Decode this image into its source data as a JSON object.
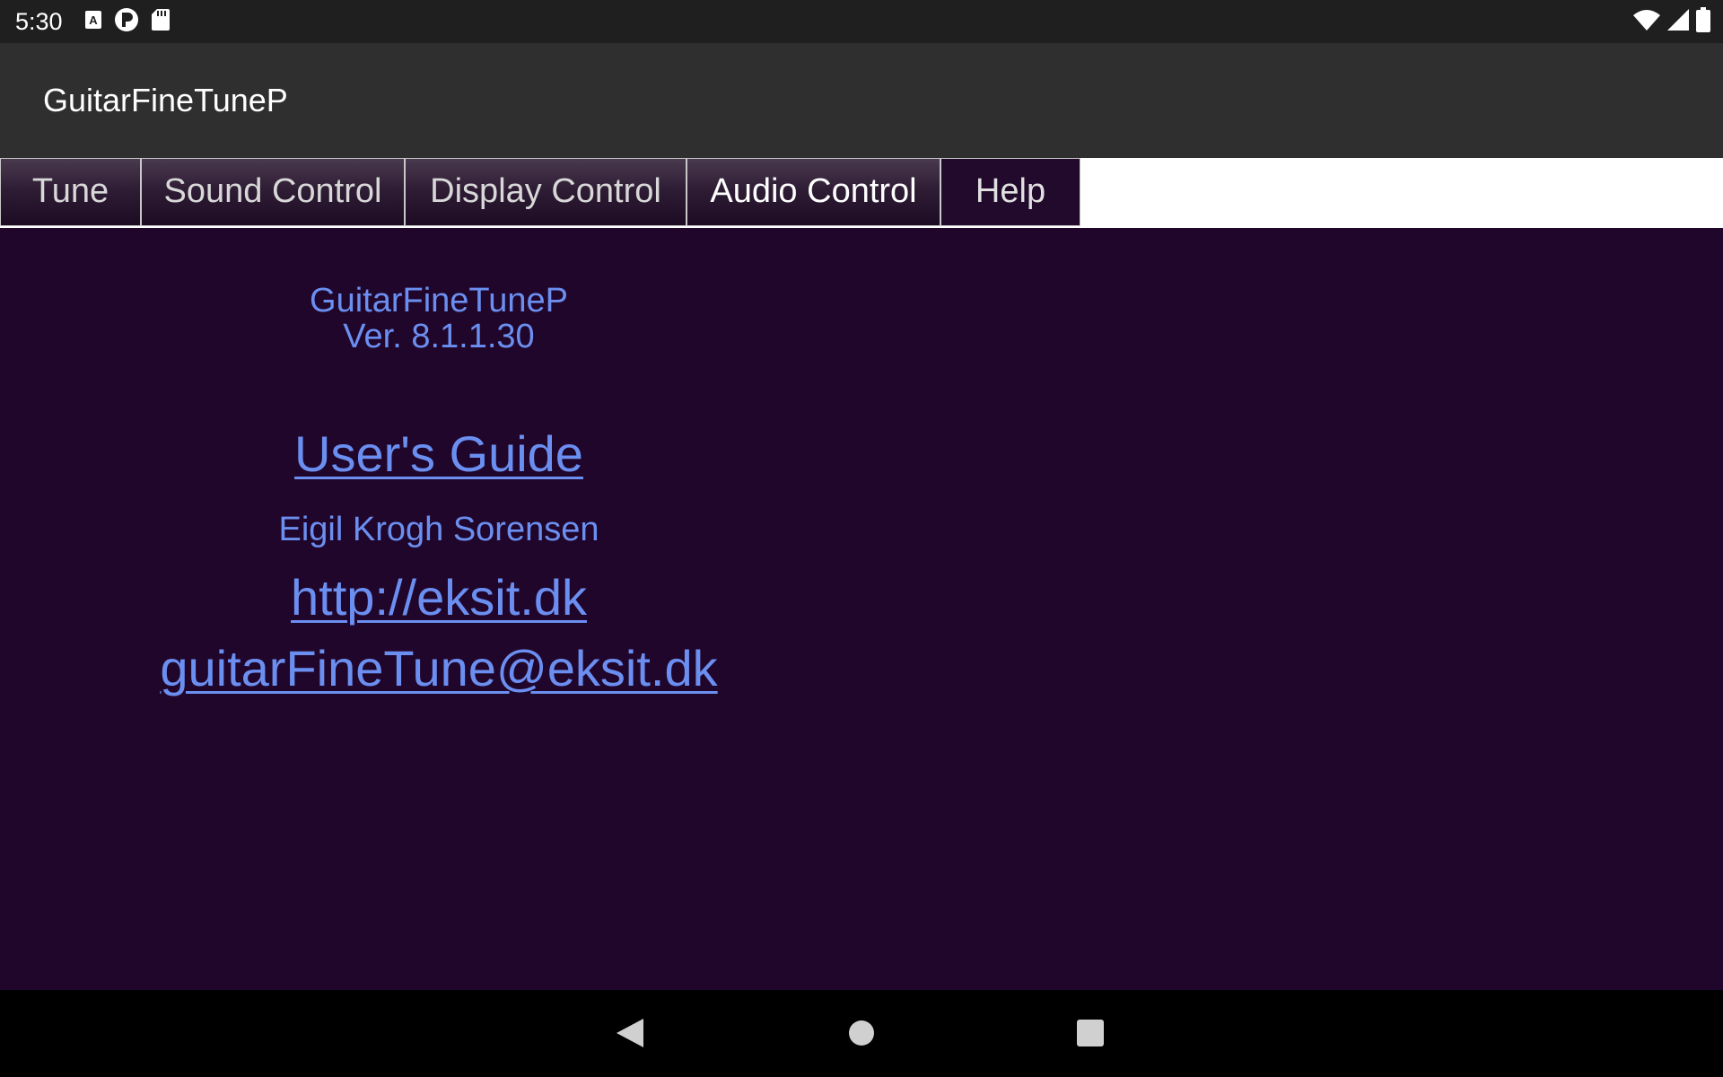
{
  "status_bar": {
    "time": "5:30",
    "left_icons": [
      "font-a-icon",
      "pocket-p-icon",
      "sd-card-icon"
    ],
    "right_icons": [
      "wifi-icon",
      "cell-signal-icon",
      "battery-icon"
    ]
  },
  "app_bar": {
    "title": "GuitarFineTuneP"
  },
  "tabs": [
    {
      "label": "Tune",
      "active": false
    },
    {
      "label": "Sound Control",
      "active": false
    },
    {
      "label": "Display Control",
      "active": false
    },
    {
      "label": "Audio Control",
      "active": false
    },
    {
      "label": "Help",
      "active": true
    }
  ],
  "help": {
    "app_name": "GuitarFineTuneP",
    "version": "Ver. 8.1.1.30",
    "users_guide_link": "User's Guide",
    "author": "Eigil Krogh Sorensen",
    "website_link": "http://eksit.dk",
    "email_link": "guitarFineTune@eksit.dk"
  },
  "nav_bar": {
    "buttons": [
      "back-icon",
      "home-icon",
      "recents-icon"
    ]
  },
  "colors": {
    "content_background": "#21062c",
    "link_color": "#6b8ff0",
    "app_bar": "#2f2f2f",
    "status_bar": "#1f1f1f"
  }
}
